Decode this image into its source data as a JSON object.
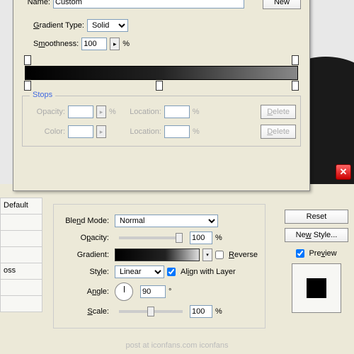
{
  "name_label": "Name:",
  "name_value": "Custom",
  "new_btn": "New",
  "gradtype_label": "Gradient Type:",
  "gradtype_value": "Solid",
  "smooth_label": "Smoothness:",
  "smooth_value": "100",
  "pct": "%",
  "stops_legend": "Stops",
  "opacity_label": "Opacity:",
  "color_label": "Color:",
  "location_label": "Location:",
  "delete_btn": "Delete",
  "blend_label": "Blend Mode:",
  "blend_value": "Normal",
  "opacity2_value": "100",
  "gradient_label": "Gradient:",
  "reverse_label": "Reverse",
  "style_label": "Style:",
  "style_value": "Linear",
  "align_label": "Align with Layer",
  "angle_label": "Angle:",
  "angle_value": "90",
  "deg": "°",
  "scale_label": "Scale:",
  "scale_value": "100",
  "side_default": "Default",
  "side_oss": "oss",
  "reset_btn": "Reset",
  "newstyle_btn": "New Style...",
  "preview_label": "Preview",
  "credit": "post at iconfans.com iconfans",
  "arrow": "▸",
  "down": "▾"
}
